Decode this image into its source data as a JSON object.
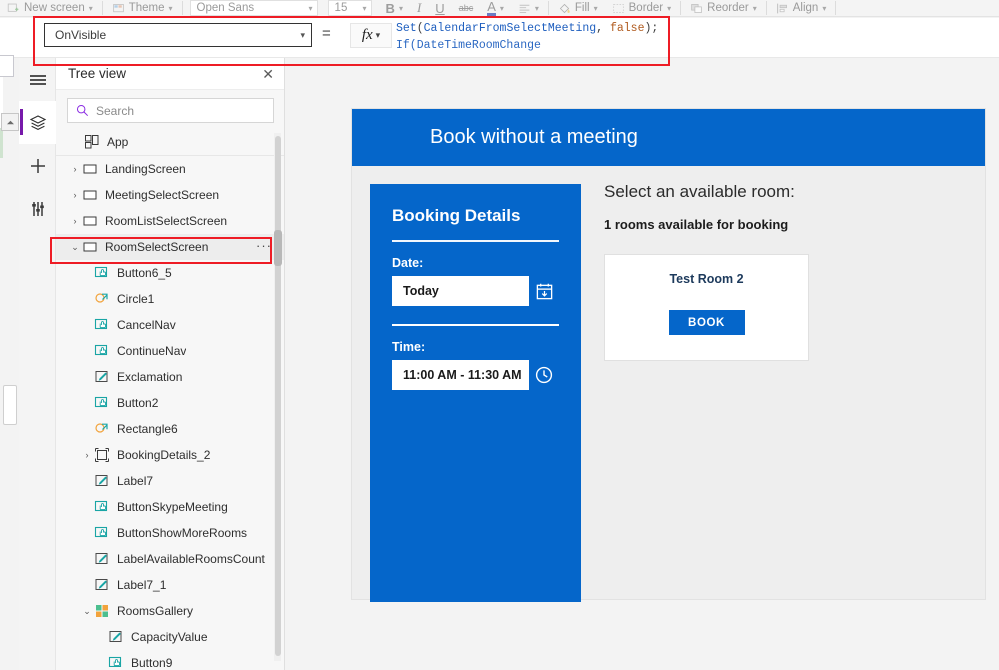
{
  "toolbar": {
    "items": [
      {
        "label": "New screen",
        "icon": "new-screen-icon",
        "caret": true
      },
      {
        "label": "Theme",
        "icon": "theme-icon",
        "caret": true
      }
    ],
    "font_family_value": "Open Sans",
    "font_size_value": "15",
    "bold_label": "B",
    "italic_label": "I",
    "underline_label": "U",
    "strikethrough_label": "abc",
    "font_color_label": "A",
    "align_label": "",
    "fill_label": "Fill",
    "border_label": "Border",
    "reorder_label": "Reorder",
    "align_group_label": "Align"
  },
  "formula_bar": {
    "property_value": "OnVisible",
    "equals": "=",
    "fx_label": "fx",
    "formula_line1_fn": "Set",
    "formula_line1_open": "(",
    "formula_line1_arg": "CalendarFromSelectMeeting",
    "formula_line1_comma": ", ",
    "formula_line1_val": "false",
    "formula_line1_close": ");",
    "formula_line2": "If(DateTimeRoomChange"
  },
  "rail": {
    "items": [
      {
        "name": "menu-icon",
        "label": "Menu"
      },
      {
        "name": "layers-icon",
        "label": "Tree view",
        "active": true
      },
      {
        "name": "plus-icon",
        "label": "Insert"
      },
      {
        "name": "settings-sliders-icon",
        "label": "Data"
      }
    ]
  },
  "tree": {
    "title": "Tree view",
    "close_label": "✕",
    "search_placeholder": "Search",
    "ellipsis_label": "···",
    "items": [
      {
        "label": "App",
        "icon": "app-icon",
        "depth": 0,
        "chevron": "",
        "type": "app"
      },
      {
        "label": "LandingScreen",
        "icon": "screen-icon",
        "depth": 0,
        "chevron": "›",
        "type": "screen"
      },
      {
        "label": "MeetingSelectScreen",
        "icon": "screen-icon",
        "depth": 0,
        "chevron": "›",
        "type": "screen"
      },
      {
        "label": "RoomListSelectScreen",
        "icon": "screen-icon",
        "depth": 0,
        "chevron": "›",
        "type": "screen"
      },
      {
        "label": "RoomSelectScreen",
        "icon": "screen-icon",
        "depth": 0,
        "chevron": "⌄",
        "type": "screen",
        "selected": true
      },
      {
        "label": "Button6_5",
        "icon": "button-icon",
        "depth": 1,
        "chevron": "",
        "type": "button"
      },
      {
        "label": "Circle1",
        "icon": "shape-icon",
        "depth": 1,
        "chevron": "",
        "type": "shape"
      },
      {
        "label": "CancelNav",
        "icon": "button-icon",
        "depth": 1,
        "chevron": "",
        "type": "button"
      },
      {
        "label": "ContinueNav",
        "icon": "button-icon",
        "depth": 1,
        "chevron": "",
        "type": "button"
      },
      {
        "label": "Exclamation",
        "icon": "label-icon",
        "depth": 1,
        "chevron": "",
        "type": "label"
      },
      {
        "label": "Button2",
        "icon": "button-icon",
        "depth": 1,
        "chevron": "",
        "type": "button"
      },
      {
        "label": "Rectangle6",
        "icon": "shape-icon",
        "depth": 1,
        "chevron": "",
        "type": "shape"
      },
      {
        "label": "BookingDetails_2",
        "icon": "group-icon",
        "depth": 1,
        "chevron": "›",
        "type": "group"
      },
      {
        "label": "Label7",
        "icon": "label-icon",
        "depth": 1,
        "chevron": "",
        "type": "label"
      },
      {
        "label": "ButtonSkypeMeeting",
        "icon": "button-icon",
        "depth": 1,
        "chevron": "",
        "type": "button"
      },
      {
        "label": "ButtonShowMoreRooms",
        "icon": "button-icon",
        "depth": 1,
        "chevron": "",
        "type": "button"
      },
      {
        "label": "LabelAvailableRoomsCount",
        "icon": "label-icon",
        "depth": 1,
        "chevron": "",
        "type": "label"
      },
      {
        "label": "Label7_1",
        "icon": "label-icon",
        "depth": 1,
        "chevron": "",
        "type": "label"
      },
      {
        "label": "RoomsGallery",
        "icon": "gallery-icon",
        "depth": 1,
        "chevron": "⌄",
        "type": "gallery"
      },
      {
        "label": "CapacityValue",
        "icon": "label-icon",
        "depth": 2,
        "chevron": "",
        "type": "label"
      },
      {
        "label": "Button9",
        "icon": "button-icon",
        "depth": 2,
        "chevron": "",
        "type": "button"
      }
    ]
  },
  "app_preview": {
    "header_title": "Book without a meeting",
    "booking_panel": {
      "title": "Booking Details",
      "date_label": "Date:",
      "date_value": "Today",
      "date_icon": "calendar-icon",
      "time_label": "Time:",
      "time_value": "11:00 AM - 11:30 AM",
      "time_icon": "clock-icon"
    },
    "rooms": {
      "heading": "Select an available room:",
      "subheading": "1 rooms available for booking",
      "cards": [
        {
          "name": "Test Room 2",
          "button_label": "BOOK"
        }
      ]
    }
  },
  "colors": {
    "accent_blue": "#0566ca",
    "annotation_red": "#ee1c25",
    "rail_active": "#7719aa",
    "canvas_bg": "#f3f3f3",
    "panel_bg": "#f7f7f7",
    "icon_teal": "#19a5a5",
    "icon_orange": "#f2a33c"
  }
}
